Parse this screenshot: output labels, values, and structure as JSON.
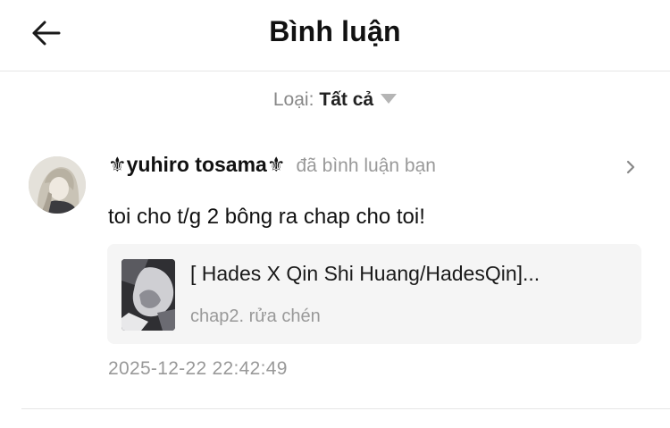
{
  "header": {
    "title": "Bình luận",
    "back_icon": "arrow-left-icon"
  },
  "filter": {
    "label": "Loại:",
    "value": "Tất cả",
    "caret_icon": "triangle-down-icon"
  },
  "comment": {
    "username": "⚜yuhiro tosama⚜",
    "action": "đã bình luận bạn",
    "text": "toi cho t/g 2 bông ra chap cho toi!",
    "chevron_icon": "chevron-right-icon",
    "card": {
      "title": "[ Hades X Qin Shi Huang/HadesQin]...",
      "subtitle": "chap2. rửa chén"
    },
    "timestamp": "2025-12-22 22:42:49"
  },
  "colors": {
    "text_primary": "#111111",
    "text_secondary": "#999999",
    "card_bg": "#f5f5f5",
    "divider": "#e6e6e6"
  }
}
